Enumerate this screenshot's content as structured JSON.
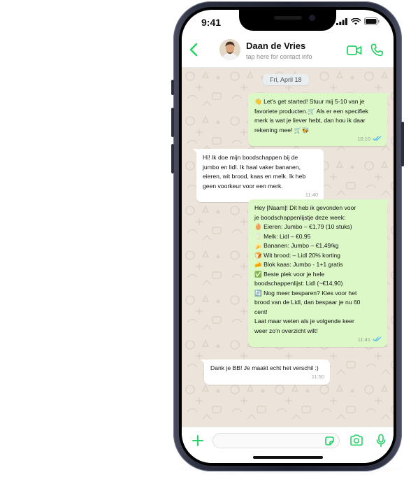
{
  "status_bar": {
    "time": "9:41",
    "icons": [
      "signal-icon",
      "wifi-icon",
      "battery-icon"
    ]
  },
  "header": {
    "contact_name": "Daan de Vries",
    "contact_subtitle": "tap here for contact info",
    "icons": [
      "back-chevron-icon",
      "video-call-icon",
      "phone-call-icon"
    ]
  },
  "chat": {
    "date_label": "Fri, April 18",
    "messages": [
      {
        "direction": "outgoing",
        "lines": [
          "👋 Let's get started! Stuur mij 5-10 van je",
          "favoriete producten.🛒 Als er een specifiek",
          "merk is wat je liever hebt, dan hou ik daar",
          "rekening mee! 🛒🐝"
        ],
        "time": "10:10",
        "status": "read"
      },
      {
        "direction": "incoming",
        "lines": [
          "Hi! Ik doe mijn boodschappen bij de",
          "jumbo en lidl. Ik haal vaker bananen,",
          "eieren, wit brood, kaas en melk. Ik heb",
          "geen voorkeur voor een merk."
        ],
        "time": "11:40"
      },
      {
        "direction": "outgoing",
        "lines": [
          "Hey [Naam]! Dit heb ik gevonden voor",
          "je boodschappenlijstje deze week:",
          "🥚 Eieren: Jumbo – €1,79 (10 stuks)",
          "🥛 Melk: Lidl – €0,95",
          "🍌 Bananen: Jumbo – €1,49/kg",
          "🍞 Wit brood: – Lidl 20% korting",
          "🧀 Blok kaas: Jumbo - 1+1 gratis",
          "✅ Beste plek voor je hele",
          "boodschappenlijst: Lidl (~€14,90)",
          "🔄 Nog meer besparen? Kies voor het",
          "brood van de Lidl, dan bespaar je nu 60",
          "cent!",
          "Laat maar weten als je volgende keer",
          "weer zo'n overzicht wilt!"
        ],
        "time": "11:41",
        "status": "read"
      },
      {
        "direction": "incoming",
        "lines": [
          "Dank je BB! Je maakt echt het verschil :)"
        ],
        "time": "11:50"
      }
    ]
  },
  "input_bar": {
    "placeholder": "",
    "icons": [
      "plus-icon",
      "sticker-icon",
      "camera-icon",
      "microphone-icon"
    ]
  },
  "colors": {
    "accent": "#25d366",
    "outgoing_bubble": "#dcf8c6",
    "incoming_bubble": "#ffffff",
    "chat_background": "#ece4da",
    "read_ticks": "#4fb6ec"
  }
}
